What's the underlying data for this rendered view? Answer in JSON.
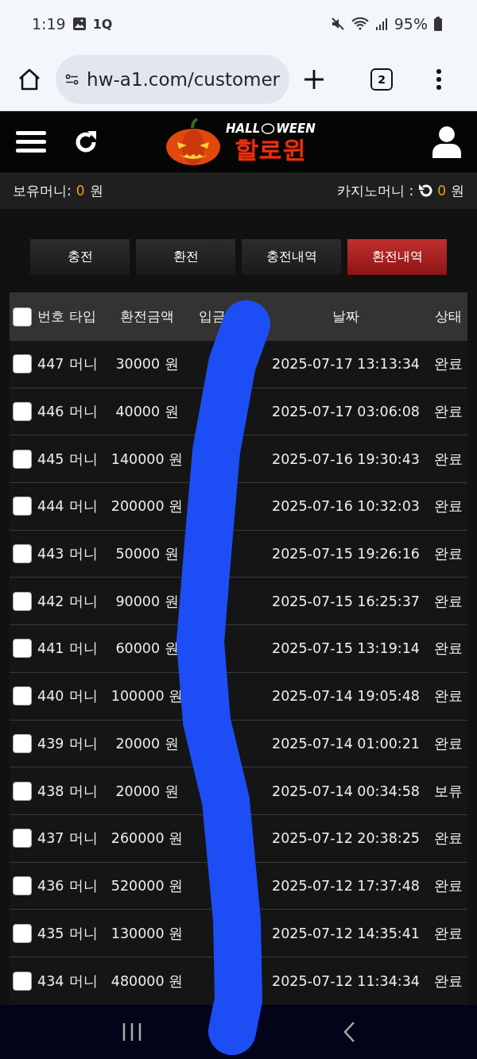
{
  "status_bar": {
    "time": "1:19",
    "app_badge": "1Q",
    "battery": "95%"
  },
  "browser": {
    "url": "hw-a1.com/customer",
    "tab_count": "2"
  },
  "header": {
    "logo_top": [
      "HALL",
      "WEEN"
    ],
    "logo_main": "할로윈"
  },
  "balance": {
    "own_label": "보유머니:",
    "own_value": "0",
    "own_unit": "원",
    "casino_label": "카지노머니 :",
    "casino_value": "0",
    "casino_unit": "원"
  },
  "tabs": [
    {
      "label": "충전",
      "selected": false
    },
    {
      "label": "환전",
      "selected": false
    },
    {
      "label": "충전내역",
      "selected": false
    },
    {
      "label": "환전내역",
      "selected": true
    }
  ],
  "table": {
    "header_checked": false,
    "columns": [
      "번호",
      "타입",
      "환전금액",
      "입금",
      "날짜",
      "상태"
    ],
    "rows": [
      {
        "checked": false,
        "no": "447",
        "type": "머니",
        "amount": "30000 원",
        "date": "2025-07-17 13:13:34",
        "status": "완료"
      },
      {
        "checked": false,
        "no": "446",
        "type": "머니",
        "amount": "40000 원",
        "date": "2025-07-17 03:06:08",
        "status": "완료"
      },
      {
        "checked": false,
        "no": "445",
        "type": "머니",
        "amount": "140000 원",
        "date": "2025-07-16 19:30:43",
        "status": "완료"
      },
      {
        "checked": false,
        "no": "444",
        "type": "머니",
        "amount": "200000 원",
        "date": "2025-07-16 10:32:03",
        "status": "완료"
      },
      {
        "checked": false,
        "no": "443",
        "type": "머니",
        "amount": "50000 원",
        "date": "2025-07-15 19:26:16",
        "status": "완료"
      },
      {
        "checked": false,
        "no": "442",
        "type": "머니",
        "amount": "90000 원",
        "date": "2025-07-15 16:25:37",
        "status": "완료"
      },
      {
        "checked": false,
        "no": "441",
        "type": "머니",
        "amount": "60000 원",
        "date": "2025-07-15 13:19:14",
        "status": "완료"
      },
      {
        "checked": false,
        "no": "440",
        "type": "머니",
        "amount": "100000 원",
        "date": "2025-07-14 19:05:48",
        "status": "완료"
      },
      {
        "checked": false,
        "no": "439",
        "type": "머니",
        "amount": "20000 원",
        "date": "2025-07-14 01:00:21",
        "status": "완료"
      },
      {
        "checked": false,
        "no": "438",
        "type": "머니",
        "amount": "20000 원",
        "date": "2025-07-14 00:34:58",
        "status": "보류"
      },
      {
        "checked": false,
        "no": "437",
        "type": "머니",
        "amount": "260000 원",
        "date": "2025-07-12 20:38:25",
        "status": "완료"
      },
      {
        "checked": false,
        "no": "436",
        "type": "머니",
        "amount": "520000 원",
        "date": "2025-07-12 17:37:48",
        "status": "완료"
      },
      {
        "checked": false,
        "no": "435",
        "type": "머니",
        "amount": "130000 원",
        "date": "2025-07-12 14:35:41",
        "status": "완료"
      },
      {
        "checked": false,
        "no": "434",
        "type": "머니",
        "amount": "480000 원",
        "date": "2025-07-12 11:34:34",
        "status": "완료"
      }
    ]
  }
}
